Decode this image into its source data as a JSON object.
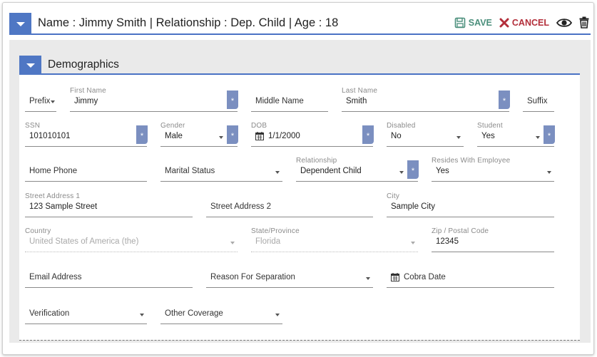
{
  "header": {
    "title": "Name : Jimmy Smith | Relationship : Dep. Child | Age : 18",
    "save_label": "SAVE",
    "cancel_label": "CANCEL"
  },
  "section": {
    "title": "Demographics"
  },
  "fields": {
    "prefix": {
      "placeholder": "Prefix"
    },
    "first_name": {
      "label": "First Name",
      "value": "Jimmy"
    },
    "middle_name": {
      "placeholder": "Middle Name"
    },
    "last_name": {
      "label": "Last Name",
      "value": "Smith"
    },
    "suffix": {
      "placeholder": "Suffix"
    },
    "ssn": {
      "label": "SSN",
      "value": "101010101"
    },
    "gender": {
      "label": "Gender",
      "value": "Male"
    },
    "dob": {
      "label": "DOB",
      "value": "1/1/2000"
    },
    "disabled": {
      "label": "Disabled",
      "value": "No"
    },
    "student": {
      "label": "Student",
      "value": "Yes"
    },
    "home_phone": {
      "placeholder": "Home Phone"
    },
    "marital_status": {
      "placeholder": "Marital Status"
    },
    "relationship": {
      "label": "Relationship",
      "value": "Dependent Child"
    },
    "resides_with_employee": {
      "label": "Resides With Employee",
      "value": "Yes"
    },
    "street_address_1": {
      "label": "Street Address 1",
      "value": "123 Sample Street"
    },
    "street_address_2": {
      "placeholder": "Street Address 2"
    },
    "city": {
      "label": "City",
      "value": "Sample City"
    },
    "country": {
      "label": "Country",
      "value": "United States of America (the)"
    },
    "state": {
      "label": "State/Province",
      "value": "Florida"
    },
    "zip": {
      "label": "Zip / Postal Code",
      "value": "12345"
    },
    "email": {
      "placeholder": "Email Address"
    },
    "reason_for_separation": {
      "placeholder": "Reason For Separation"
    },
    "cobra_date": {
      "placeholder": "Cobra Date"
    },
    "verification": {
      "placeholder": "Verification"
    },
    "other_coverage": {
      "placeholder": "Other Coverage"
    }
  },
  "required_marker": "*",
  "colors": {
    "accent": "#4f77c4",
    "save": "#4b8f7c",
    "cancel": "#b32e3a",
    "required": "#7b8fc0"
  },
  "icons": [
    "chevron-down-icon",
    "save-icon",
    "close-icon",
    "eye-icon",
    "trash-icon",
    "calendar-icon"
  ]
}
